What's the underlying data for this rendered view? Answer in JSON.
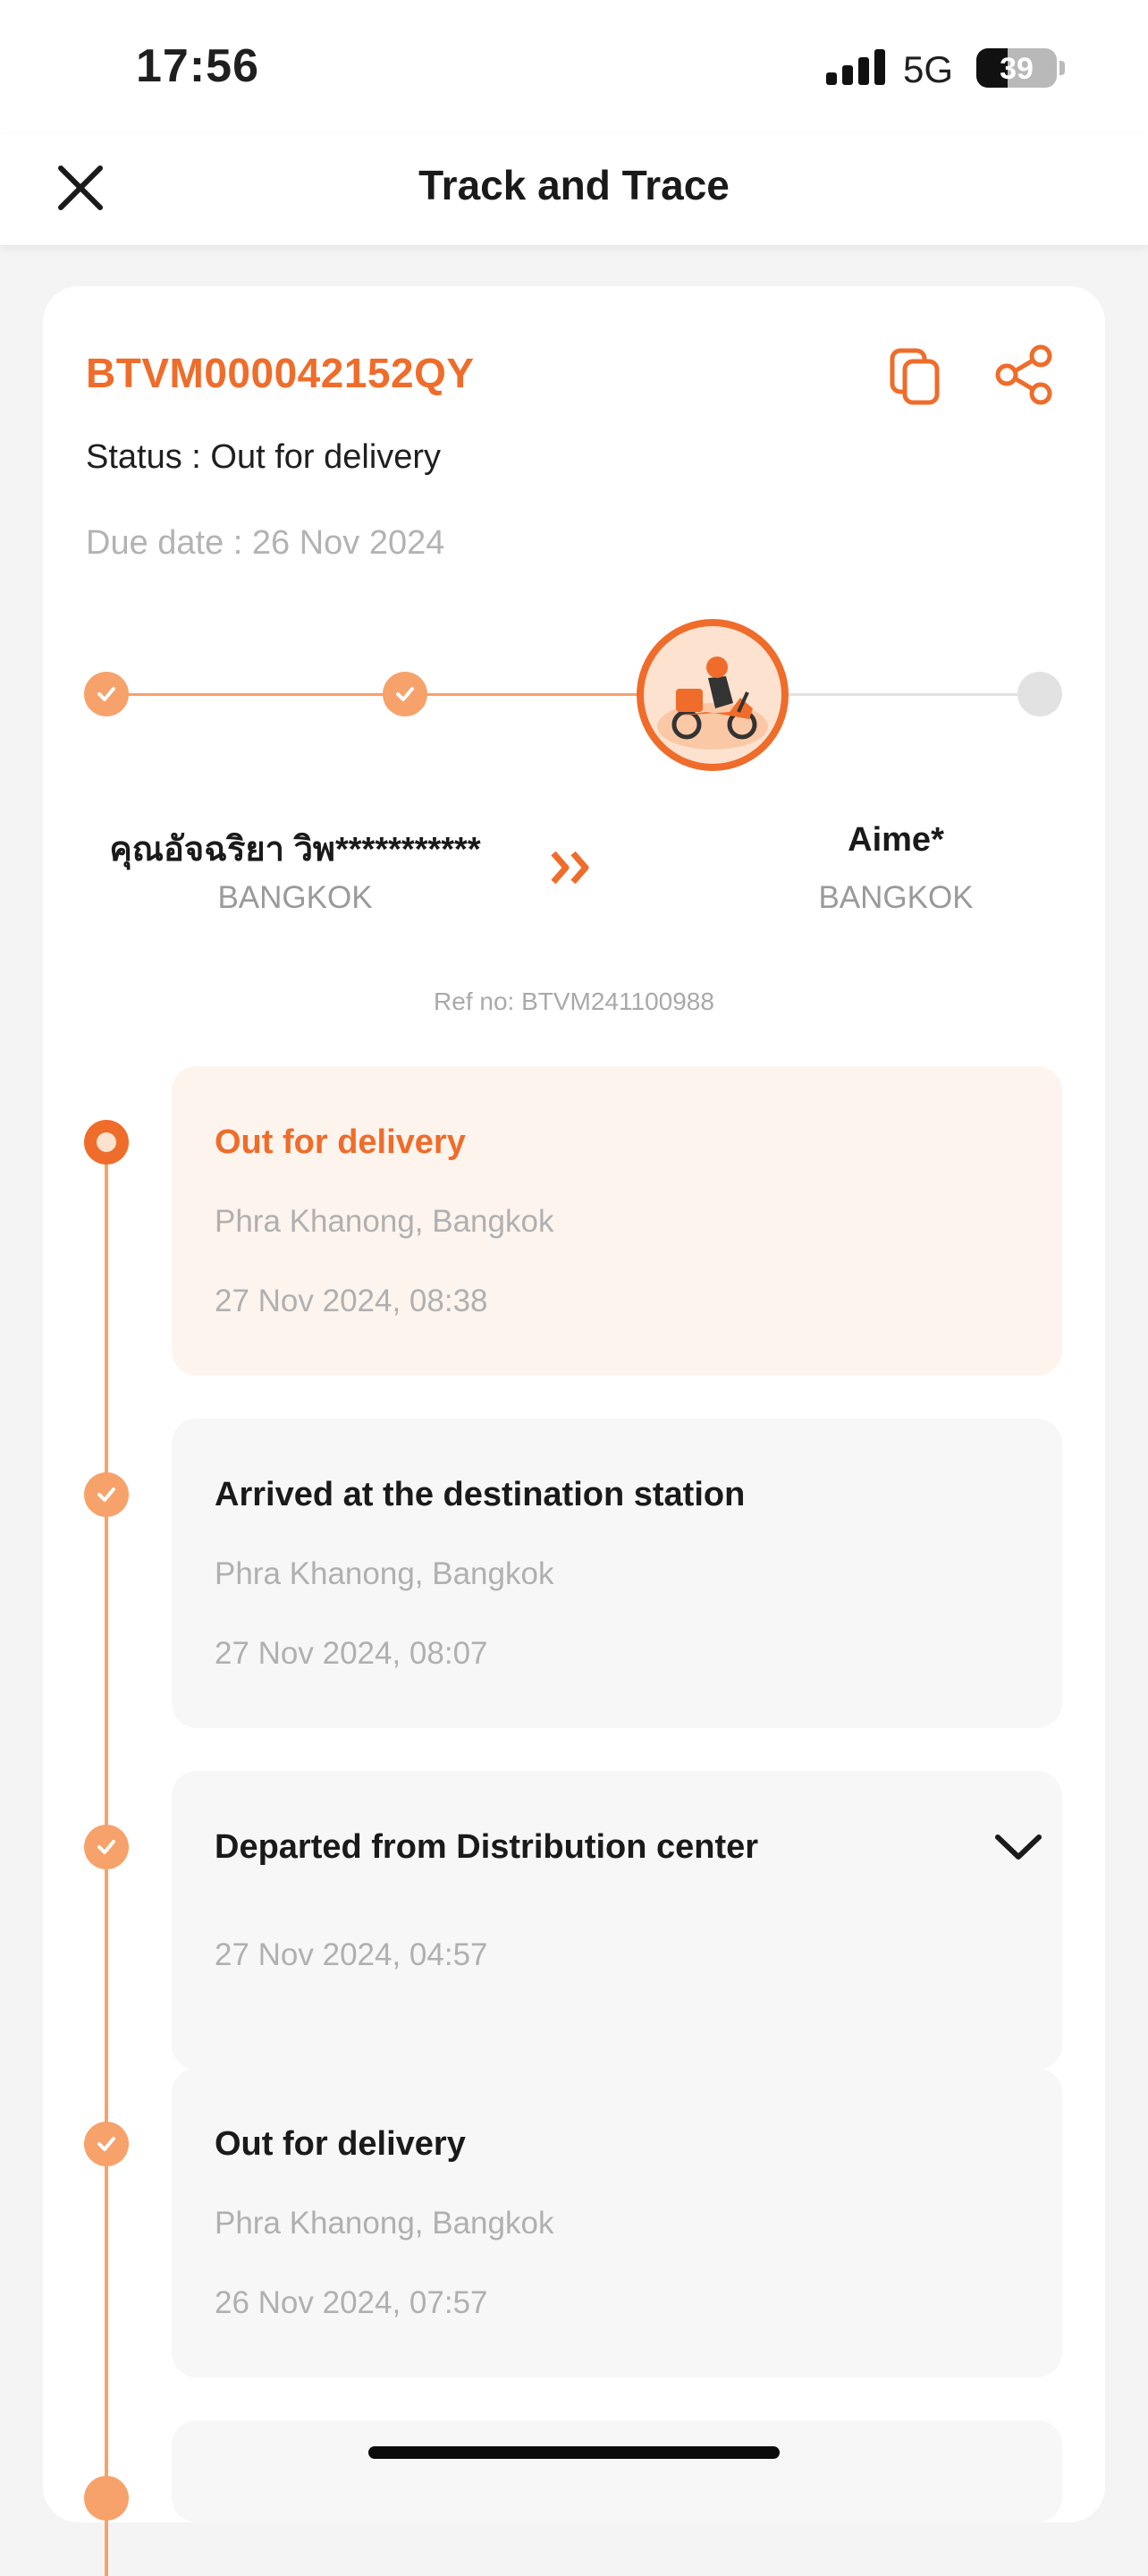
{
  "status_bar": {
    "time": "17:56",
    "network": "5G",
    "battery": "39"
  },
  "header": {
    "title": "Track and Trace"
  },
  "shipment": {
    "tracking_number": "BTVM000042152QY",
    "status": "Status : Out for delivery",
    "due_date": "Due date : 26 Nov 2024",
    "sender": {
      "name": "คุณอัจฉริยา วิพ***********",
      "city": "BANGKOK"
    },
    "receiver": {
      "name": "Aime*",
      "city": "BANGKOK"
    },
    "ref_no": "Ref no: BTVM241100988"
  },
  "colors": {
    "accent": "#ef6c2a",
    "accent_light": "#f6a26a",
    "current_bg": "#fef4ee"
  },
  "events": [
    {
      "title": "Out for delivery",
      "location": "Phra Khanong, Bangkok",
      "time": "27 Nov 2024, 08:38"
    },
    {
      "title": "Arrived at the destination station",
      "location": "Phra Khanong, Bangkok",
      "time": "27 Nov 2024, 08:07"
    },
    {
      "title": "Departed from Distribution center",
      "time": "27 Nov 2024, 04:57"
    },
    {
      "title": "Out for delivery",
      "location": "Phra Khanong, Bangkok",
      "time": "26 Nov 2024, 07:57"
    }
  ]
}
